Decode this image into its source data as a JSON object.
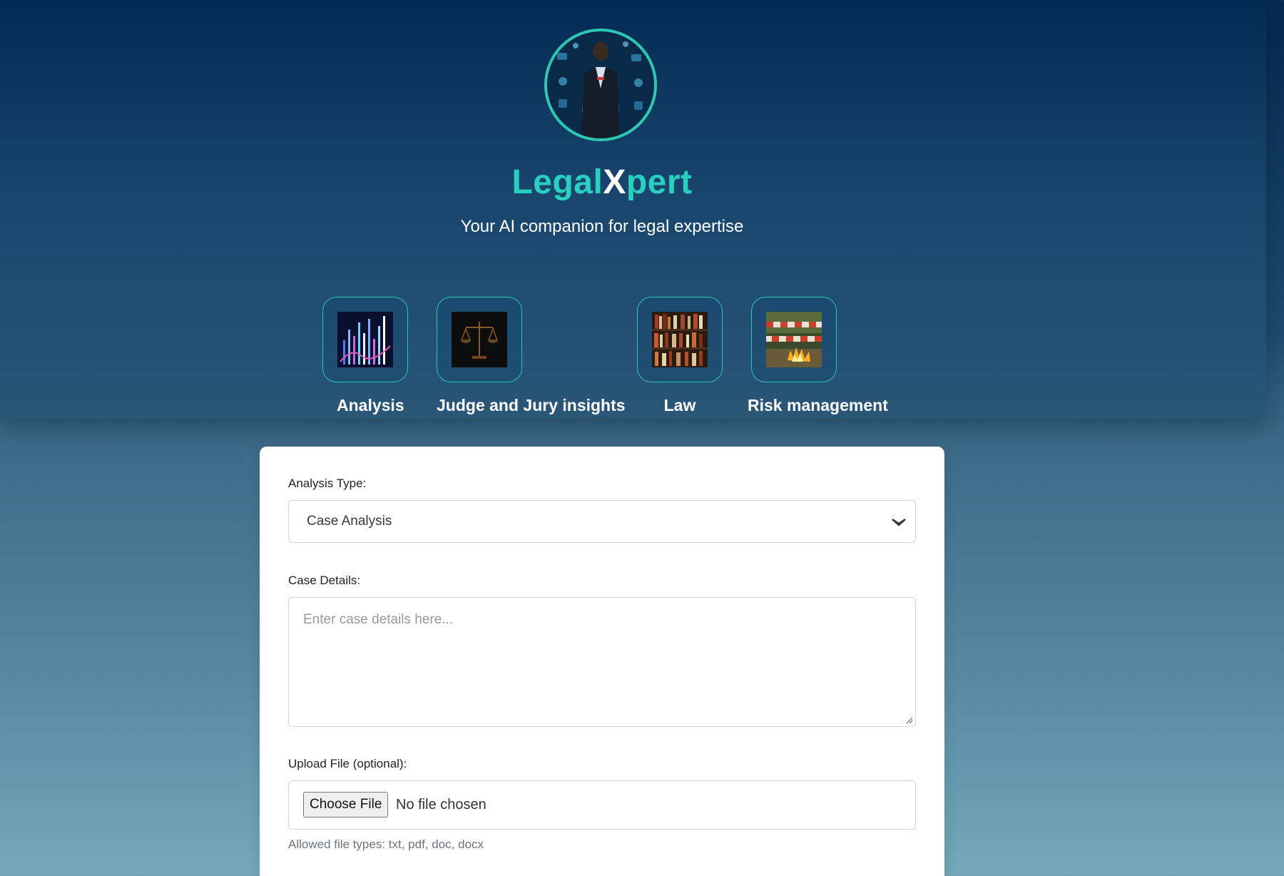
{
  "app": {
    "brand_part1": "Legal",
    "brand_part2": "X",
    "brand_part3": "pert",
    "subtitle": "Your AI companion for legal expertise",
    "accent_color": "#2dc7b2"
  },
  "features": [
    {
      "label": "Analysis",
      "icon": "analysis-chart-icon"
    },
    {
      "label": "Judge and Jury insights",
      "icon": "scales-of-justice-icon"
    },
    {
      "label": "Law",
      "icon": "bookshelf-icon"
    },
    {
      "label": "Risk management",
      "icon": "hazard-barrier-icon"
    }
  ],
  "form": {
    "analysis_type_label": "Analysis Type:",
    "analysis_type_value": "Case Analysis",
    "case_details_label": "Case Details:",
    "case_details_placeholder": "Enter case details here...",
    "upload_label": "Upload File (optional):",
    "choose_file_label": "Choose File",
    "no_file_text": "No file chosen",
    "allowed_types": "Allowed file types: txt, pdf, doc, docx"
  }
}
